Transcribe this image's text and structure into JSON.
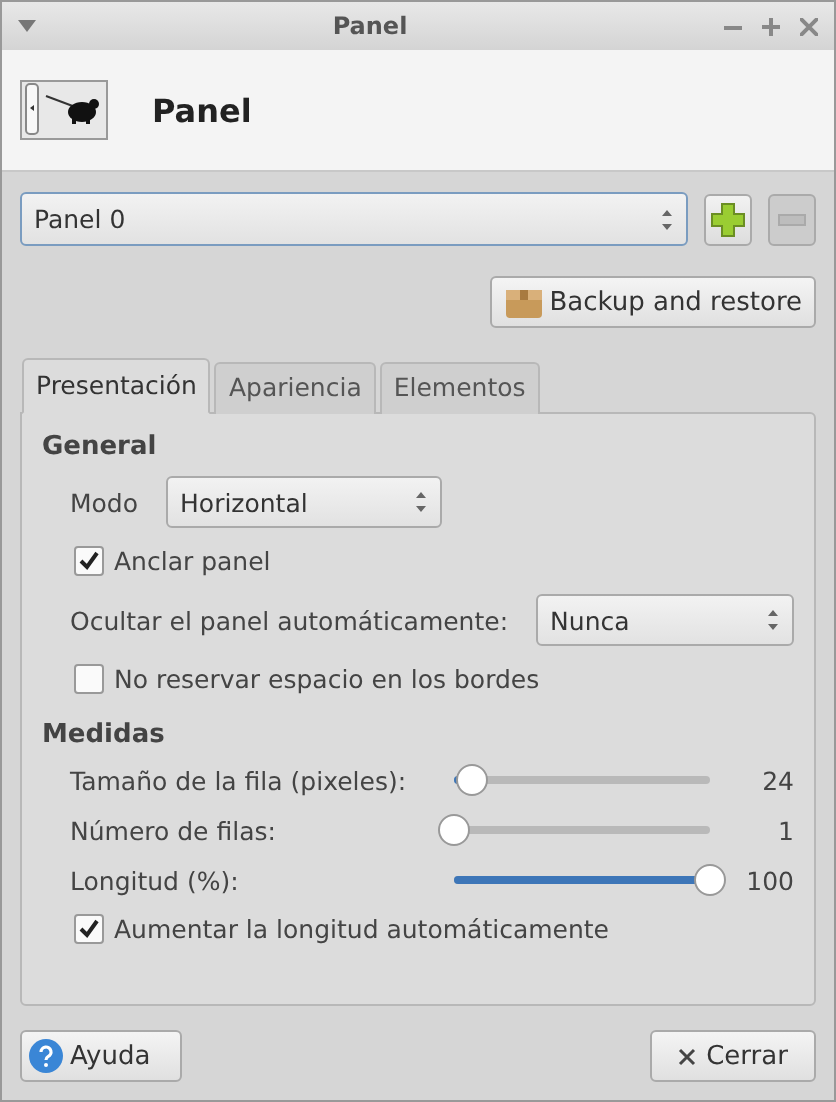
{
  "window": {
    "title": "Panel"
  },
  "header": {
    "title": "Panel"
  },
  "panel_select": {
    "value": "Panel 0"
  },
  "add_button": {
    "disabled": false
  },
  "remove_button": {
    "disabled": true
  },
  "backup_button": {
    "label": "Backup and restore"
  },
  "tabs": [
    {
      "label": "Presentación",
      "selected": true
    },
    {
      "label": "Apariencia",
      "selected": false
    },
    {
      "label": "Elementos",
      "selected": false
    }
  ],
  "general": {
    "heading": "General",
    "mode_label": "Modo",
    "mode_value": "Horizontal",
    "lock": {
      "label": "Anclar panel",
      "checked": true
    },
    "autohide_label": "Ocultar el panel automáticamente:",
    "autohide_value": "Nunca",
    "reserve": {
      "label": "No reservar espacio en los bordes",
      "checked": false
    }
  },
  "measures": {
    "heading": "Medidas",
    "sliders": [
      {
        "label": "Tamaño de la fila (pixeles):",
        "level": 0.07,
        "reading": "24"
      },
      {
        "label": "Número de filas:",
        "level": 0.0,
        "reading": "1"
      },
      {
        "label": "Longitud (%):",
        "level": 1.0,
        "reading": "100"
      }
    ],
    "autolength": {
      "label": "Aumentar la longitud automáticamente",
      "checked": true
    }
  },
  "footer": {
    "help": "Ayuda",
    "close": "Cerrar"
  }
}
